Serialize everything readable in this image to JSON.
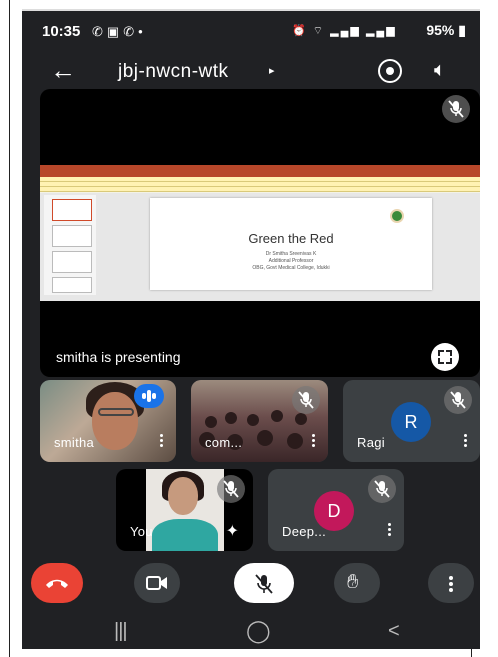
{
  "status_bar": {
    "time": "10:35",
    "left_icons": [
      "whatsapp-icon",
      "gallery-icon",
      "whatsapp-icon",
      "dot-icon"
    ],
    "right_icons": [
      "alarm-icon",
      "wifi-icon",
      "lte-signal-icon",
      "lte-signal-icon"
    ],
    "battery": "95%"
  },
  "top_bar": {
    "meeting_code": "jbj-nwcn-wtk",
    "caret": "▸"
  },
  "presentation": {
    "slide_title": "Green the Red",
    "slide_line1": "Dr Smitha Sreenivas K",
    "slide_line2": "Additional Professor",
    "slide_line3": "OBG, Govt Medical College, Idukki",
    "label": "smitha is presenting"
  },
  "participants": [
    {
      "name": "smitha",
      "status": "speaking"
    },
    {
      "name": "com...",
      "status": "muted"
    },
    {
      "name": "Ragi",
      "initial": "R",
      "avatar_color": "#1558a6",
      "status": "muted"
    },
    {
      "name": "You",
      "status": "muted"
    },
    {
      "name": "Deep...",
      "initial": "D",
      "avatar_color": "#c2185b",
      "status": "muted"
    }
  ],
  "controls": [
    "end-call",
    "camera",
    "microphone-off",
    "raise-hand",
    "more-options"
  ],
  "nav": {
    "recents": "|||",
    "home": "◯",
    "back": "<"
  },
  "colors": {
    "background": "#202124",
    "tile": "#3c4043",
    "end_call": "#ea4335",
    "speaking": "#1a73e8"
  }
}
